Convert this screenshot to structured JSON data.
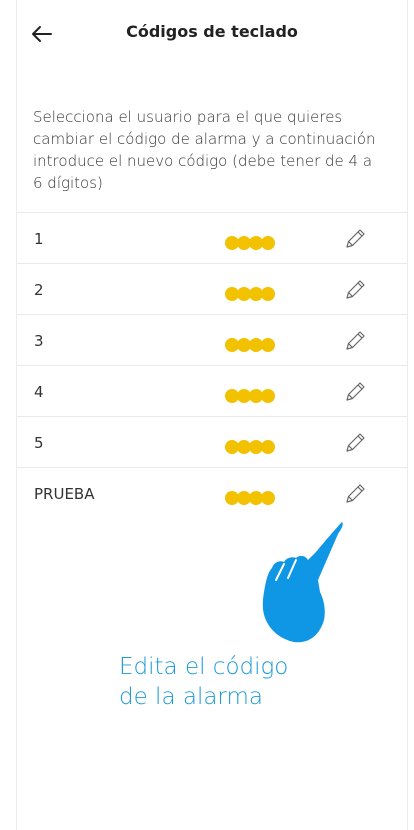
{
  "header": {
    "title": "Códigos de teclado"
  },
  "description": "Selecciona el usuario para el que quieres cambiar el código de alarma y a continuación introduce el nuevo código (debe tener de 4 a 6 dígitos)",
  "users": [
    {
      "label": "1",
      "code_dots": 4
    },
    {
      "label": "2",
      "code_dots": 4
    },
    {
      "label": "3",
      "code_dots": 4
    },
    {
      "label": "4",
      "code_dots": 4
    },
    {
      "label": "5",
      "code_dots": 4
    },
    {
      "label": "PRUEBA",
      "code_dots": 4
    }
  ],
  "annotation": {
    "line1": "Edita el código",
    "line2": "de la alarma",
    "color": "#1a9ad6"
  },
  "icons": {
    "back": "arrow-left-icon",
    "edit": "pencil-icon",
    "hand": "pointing-hand-icon"
  },
  "colors": {
    "dot": "#f2c200",
    "hand": "#0f97e6",
    "caption": "#1a9ad6"
  }
}
